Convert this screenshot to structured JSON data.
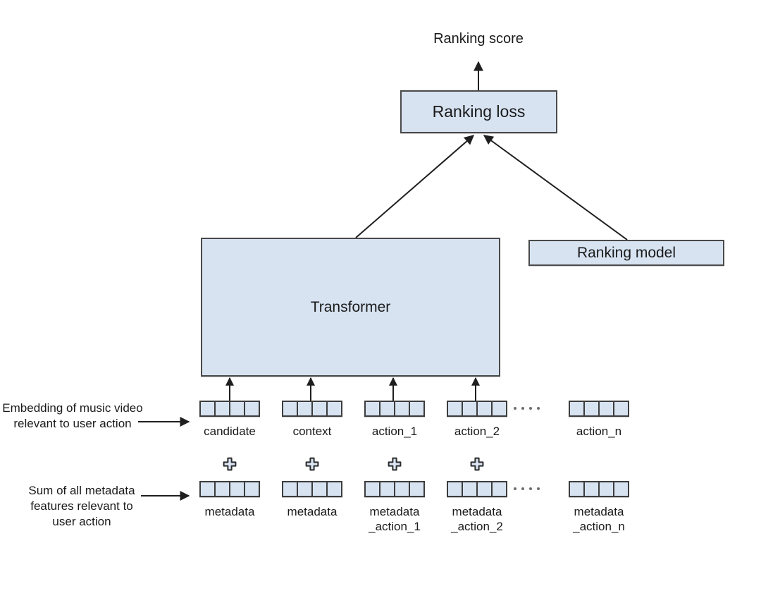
{
  "diagram": {
    "title": "Ranking model architecture with transformer over user action sequence",
    "background": "#ffffff",
    "box_fill": "#d7e3f1",
    "box_stroke": "#4a4a4a",
    "arrow_color": "#1f1f1f"
  },
  "nodes": {
    "ranking_score": "Ranking score",
    "ranking_loss": "Ranking loss",
    "transformer": "Transformer",
    "ranking_model": "Ranking model"
  },
  "annotations": {
    "embedding_note": "Embedding of music video relevant to user action",
    "metadata_note": "Sum of all metadata features relevant to user action"
  },
  "embedding_row": {
    "cells_per_vector": 4,
    "tokens": [
      {
        "label": "candidate",
        "has_plus": true,
        "has_arrow_to_transformer": true
      },
      {
        "label": "context",
        "has_plus": true,
        "has_arrow_to_transformer": true
      },
      {
        "label": "action_1",
        "has_plus": true,
        "has_arrow_to_transformer": true
      },
      {
        "label": "action_2",
        "has_plus": true,
        "has_arrow_to_transformer": true
      },
      {
        "label": "action_n",
        "has_plus": false,
        "has_arrow_to_transformer": false
      }
    ]
  },
  "metadata_row": {
    "cells_per_vector": 4,
    "tokens": [
      {
        "label": "metadata"
      },
      {
        "label": "metadata"
      },
      {
        "label": "metadata\n_action_1"
      },
      {
        "label": "metadata\n_action_2"
      },
      {
        "label": "metadata\n_action_n"
      }
    ]
  },
  "ellipsis": {
    "dot_count": 4,
    "label": "ellipsis-between-action2-and-actionn"
  },
  "plus_symbol": "+"
}
